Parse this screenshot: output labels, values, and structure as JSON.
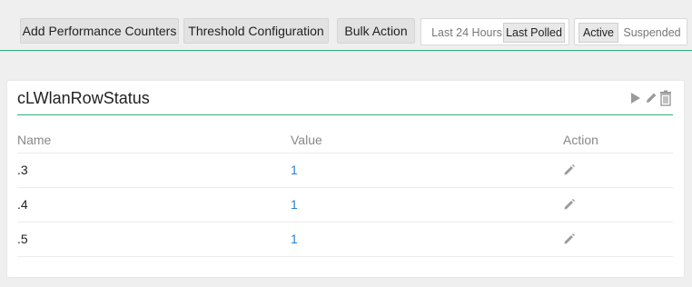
{
  "toolbar": {
    "add_counters_label": "Add Performance Counters",
    "threshold_label": "Threshold Configuration",
    "bulk_action_label": "Bulk Action",
    "time_range": {
      "options": [
        "Last 24 Hours",
        "Last Polled"
      ],
      "selected": "Last Polled"
    },
    "status": {
      "options": [
        "Active",
        "Suspended"
      ],
      "selected": "Active"
    }
  },
  "card": {
    "title": "cLWlanRowStatus",
    "columns": {
      "name": "Name",
      "value": "Value",
      "action": "Action"
    },
    "rows": [
      {
        "name": ".3",
        "value": "1"
      },
      {
        "name": ".4",
        "value": "1"
      },
      {
        "name": ".5",
        "value": "1"
      }
    ],
    "header_icons": [
      "play-icon",
      "edit-icon",
      "trash-icon"
    ],
    "row_action_icon": "edit-icon"
  },
  "colors": {
    "accent_green": "#2fb07a",
    "link_blue": "#2a7fd4",
    "background": "#efefef"
  }
}
